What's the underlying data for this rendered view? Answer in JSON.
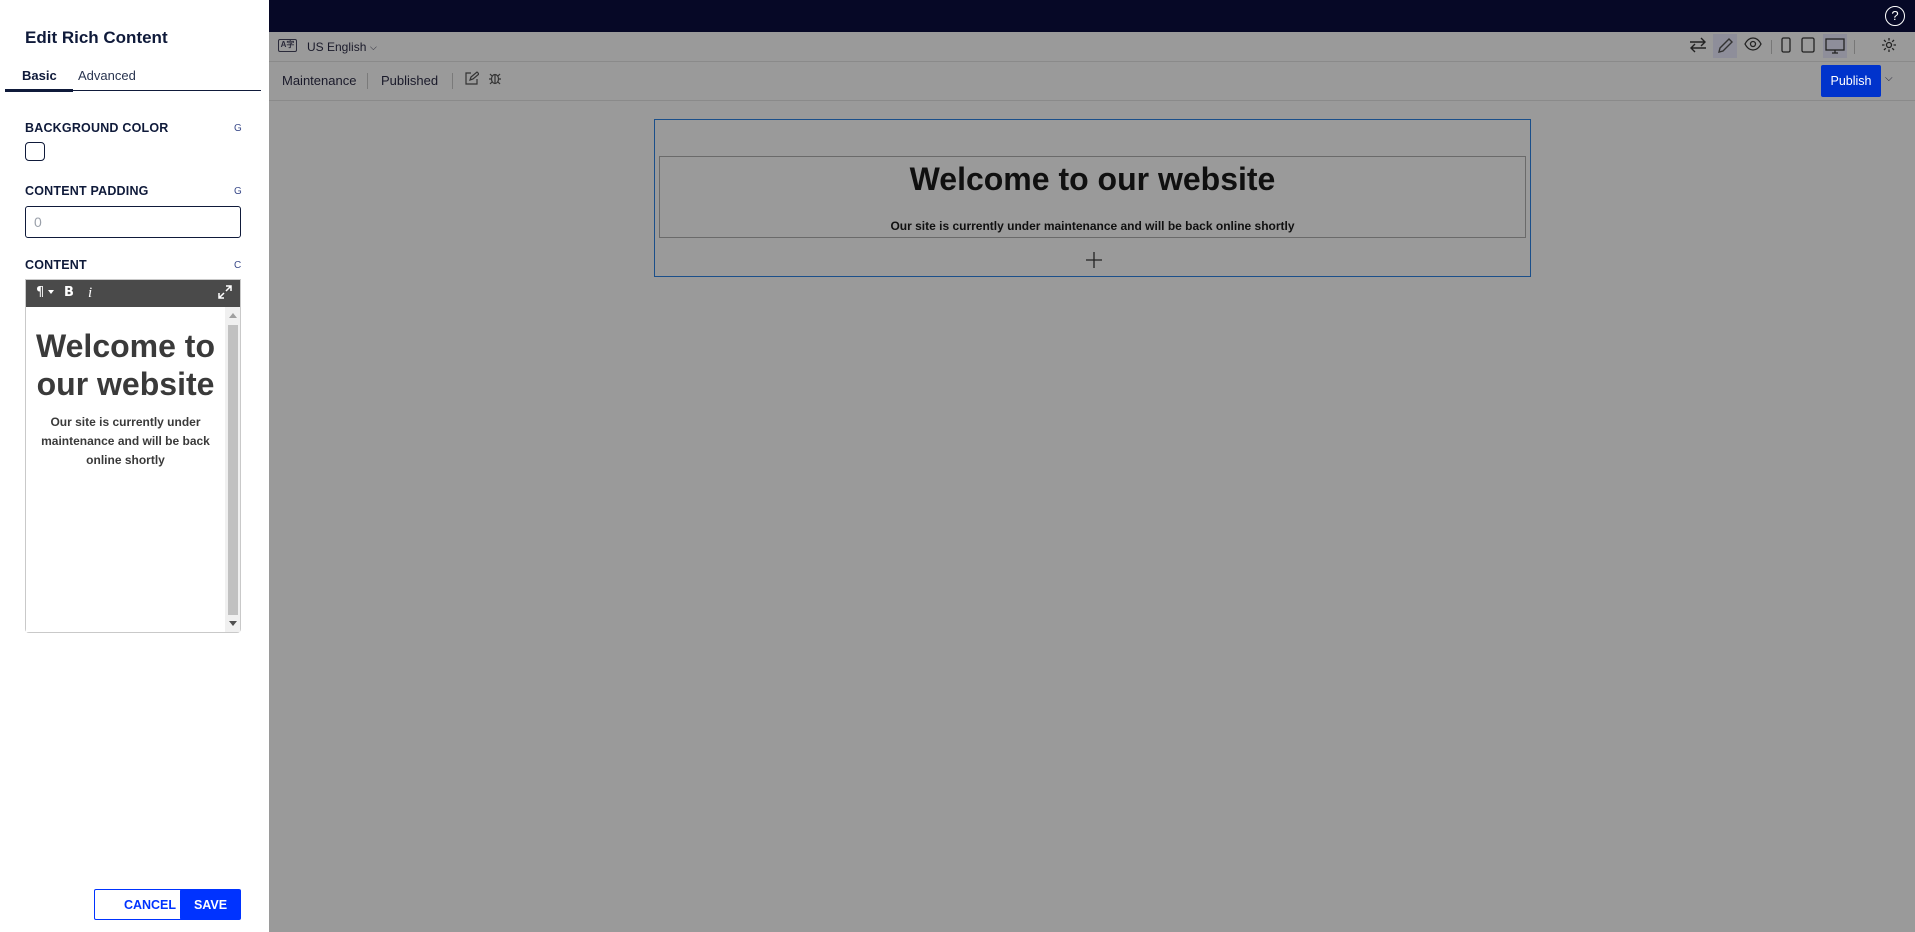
{
  "panel": {
    "title": "Edit Rich Content",
    "tabs": [
      {
        "label": "Basic"
      },
      {
        "label": "Advanced"
      }
    ],
    "fields": {
      "background_color": {
        "label": "BACKGROUND COLOR",
        "flag": "G"
      },
      "content_padding": {
        "label": "CONTENT PADDING",
        "flag": "G",
        "placeholder": "0",
        "value": ""
      },
      "content": {
        "label": "CONTENT",
        "flag": "C"
      }
    },
    "editor": {
      "toolbar": {
        "paragraph": "¶",
        "bold": "B",
        "italic": "i",
        "expand": "⤢"
      },
      "heading": "Welcome to our website",
      "paragraph": "Our site is currently under maintenance and will be back online shortly"
    },
    "cancel_label": "CANCEL",
    "save_label": "SAVE"
  },
  "topbar": {
    "help": "?"
  },
  "toolbar1": {
    "lang_icon": "A字",
    "language": "US English",
    "icons": [
      "swap-icon",
      "pencil-icon",
      "eye-icon",
      "phone-icon",
      "tablet-icon",
      "desktop-icon",
      "gear-icon"
    ]
  },
  "toolbar2": {
    "breadcrumbs": [
      "Maintenance",
      "Published"
    ],
    "publish_label": "Publish"
  },
  "canvas": {
    "heading": "Welcome to our website",
    "paragraph": "Our site is currently under maintenance and will be back online shortly",
    "add": "+"
  },
  "colors": {
    "accent": "#0033ff",
    "topbar": "#060826",
    "canvas_bg": "#9a9a9a",
    "selection": "#1b4f8a"
  }
}
